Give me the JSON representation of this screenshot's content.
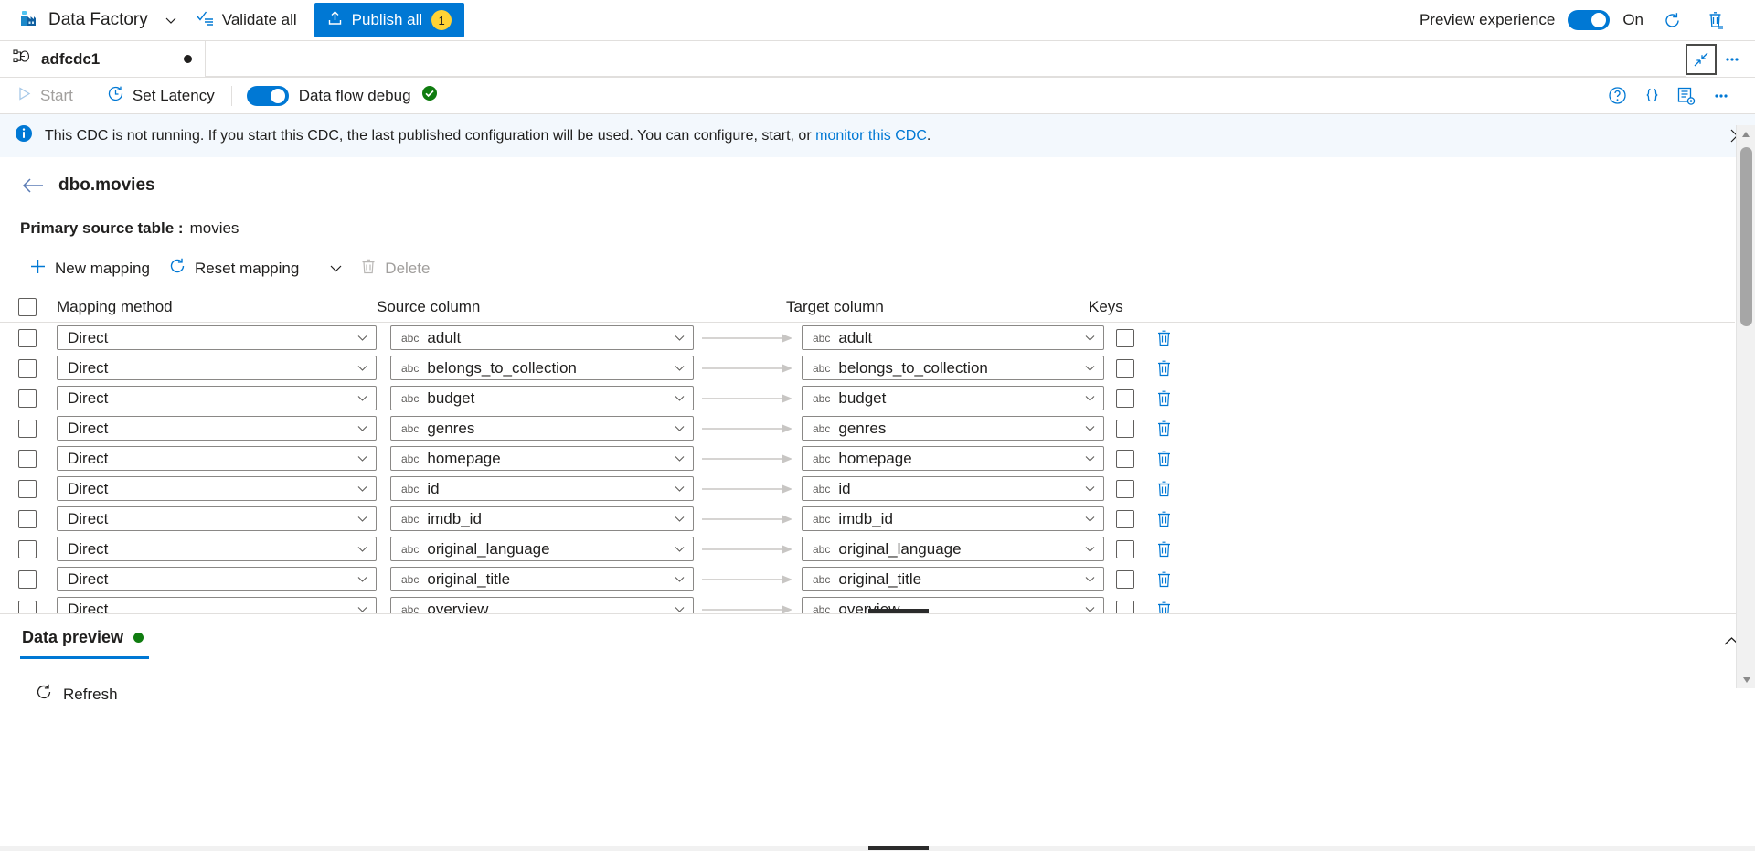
{
  "topbar": {
    "brand": "Data Factory",
    "brand_icon": "factory-icon",
    "brand_chevron": "chevron-down-icon",
    "validate_all": "Validate all",
    "validate_icon": "validate-checklist-icon",
    "publish_all": "Publish all",
    "publish_icon": "publish-upload-icon",
    "publish_count": "1",
    "preview_experience_label": "Preview experience",
    "preview_toggle_state": "On",
    "refresh_icon": "refresh-icon",
    "feedback_icon": "delete-document-icon",
    "accent_color": "#0078d4",
    "badge_color": "#ffd335"
  },
  "tabstrip": {
    "tab_label": "adfcdc1",
    "tab_icon": "cdc-resource-icon",
    "dirty_indicator": "unsaved-changes-dot",
    "collapse_icon": "collapse-diagonal-icon",
    "more_icon": "ellipsis-icon"
  },
  "cmdbar": {
    "start_label": "Start",
    "start_icon": "play-triangle-icon",
    "start_disabled": true,
    "set_latency_label": "Set Latency",
    "set_latency_icon": "clock-icon",
    "data_flow_debug_label": "Data flow debug",
    "data_flow_debug_state": "on",
    "debug_status_icon": "green-check-circle-icon",
    "help_icon": "question-circle-icon",
    "code_icon": "curly-braces-icon",
    "properties_icon": "properties-list-icon",
    "more_icon": "ellipsis-icon"
  },
  "banner": {
    "info_icon": "info-circle-icon",
    "text_before": "This CDC is not running. If you start this CDC, the last published configuration will be used. You can configure, start, or",
    "link_text": "monitor this CDC",
    "text_after": ".",
    "close_icon": "close-x-icon",
    "background": "#f3f8fd"
  },
  "page": {
    "back_icon": "back-arrow-icon",
    "title": "dbo.movies",
    "primary_source_label": "Primary source table :",
    "primary_source_value": "movies"
  },
  "mapping_toolbar": {
    "new_mapping": "New mapping",
    "new_mapping_icon": "plus-icon",
    "reset_mapping": "Reset mapping",
    "reset_mapping_icon": "refresh-icon",
    "chevron_icon": "chevron-down-icon",
    "delete": "Delete",
    "delete_icon": "trash-icon",
    "delete_disabled": true
  },
  "table": {
    "headers": {
      "select_all": "select-all-checkbox",
      "mapping_method": "Mapping method",
      "source_column": "Source column",
      "target_column": "Target column",
      "keys": "Keys"
    },
    "row_icons": {
      "type_badge": "abc",
      "arrow": "mapping-arrow-icon",
      "delete": "trash-icon",
      "dropdown_chevron": "chevron-down-icon"
    },
    "rows": [
      {
        "selected": false,
        "method": "Direct",
        "source": "adult",
        "source_type": "abc",
        "target": "adult",
        "target_type": "abc",
        "key": false
      },
      {
        "selected": false,
        "method": "Direct",
        "source": "belongs_to_collection",
        "source_type": "abc",
        "target": "belongs_to_collection",
        "target_type": "abc",
        "key": false
      },
      {
        "selected": false,
        "method": "Direct",
        "source": "budget",
        "source_type": "abc",
        "target": "budget",
        "target_type": "abc",
        "key": false
      },
      {
        "selected": false,
        "method": "Direct",
        "source": "genres",
        "source_type": "abc",
        "target": "genres",
        "target_type": "abc",
        "key": false
      },
      {
        "selected": false,
        "method": "Direct",
        "source": "homepage",
        "source_type": "abc",
        "target": "homepage",
        "target_type": "abc",
        "key": false
      },
      {
        "selected": false,
        "method": "Direct",
        "source": "id",
        "source_type": "abc",
        "target": "id",
        "target_type": "abc",
        "key": false
      },
      {
        "selected": false,
        "method": "Direct",
        "source": "imdb_id",
        "source_type": "abc",
        "target": "imdb_id",
        "target_type": "abc",
        "key": false
      },
      {
        "selected": false,
        "method": "Direct",
        "source": "original_language",
        "source_type": "abc",
        "target": "original_language",
        "target_type": "abc",
        "key": false
      },
      {
        "selected": false,
        "method": "Direct",
        "source": "original_title",
        "source_type": "abc",
        "target": "original_title",
        "target_type": "abc",
        "key": false
      },
      {
        "selected": false,
        "method": "Direct",
        "source": "overview",
        "source_type": "abc",
        "target": "overview",
        "target_type": "abc",
        "key": false
      }
    ]
  },
  "data_preview": {
    "tab_label": "Data preview",
    "status_dot": "green-status-dot",
    "collapse_icon": "chevron-up-icon",
    "refresh_label": "Refresh",
    "refresh_icon": "refresh-icon"
  }
}
